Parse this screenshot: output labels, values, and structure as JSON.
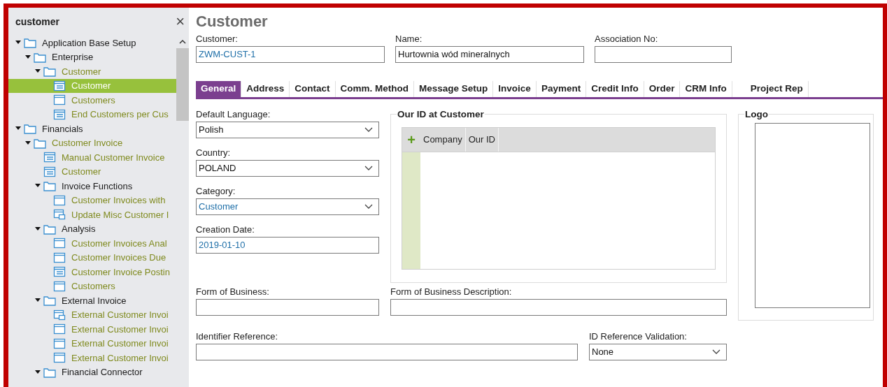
{
  "search": {
    "value": "customer",
    "close": "×"
  },
  "tree": [
    {
      "label": "Application Base Setup",
      "kind": "folder",
      "expanded": true,
      "match": false,
      "selected": false,
      "children": [
        {
          "label": "Enterprise",
          "kind": "folder",
          "expanded": true,
          "match": false,
          "selected": false,
          "children": [
            {
              "label": "Customer",
              "kind": "folder",
              "expanded": true,
              "match": true,
              "selected": false,
              "children": [
                {
                  "label": "Customer",
                  "kind": "form",
                  "selected": true
                },
                {
                  "label": "Customers",
                  "kind": "window",
                  "match": true,
                  "selected": false
                },
                {
                  "label": "End Customers per Cus",
                  "kind": "form",
                  "match": true,
                  "selected": false
                }
              ]
            }
          ]
        }
      ]
    },
    {
      "label": "Financials",
      "kind": "folder",
      "expanded": true,
      "match": false,
      "selected": false,
      "children": [
        {
          "label": "Customer Invoice",
          "kind": "folder",
          "expanded": true,
          "match": true,
          "selected": false,
          "children": [
            {
              "label": "Manual Customer Invoice",
              "kind": "form",
              "match": true,
              "selected": false
            },
            {
              "label": "Customer",
              "kind": "form",
              "match": true,
              "selected": false
            },
            {
              "label": "Invoice Functions",
              "kind": "folder",
              "expanded": true,
              "match": false,
              "selected": false,
              "children": [
                {
                  "label": "Customer Invoices with",
                  "kind": "window",
                  "match": true,
                  "selected": false
                },
                {
                  "label": "Update Misc Customer I",
                  "kind": "subwindow",
                  "match": true,
                  "selected": false
                }
              ]
            },
            {
              "label": "Analysis",
              "kind": "folder",
              "expanded": true,
              "match": false,
              "selected": false,
              "children": [
                {
                  "label": "Customer Invoices Anal",
                  "kind": "window",
                  "match": true,
                  "selected": false
                },
                {
                  "label": "Customer Invoices Due",
                  "kind": "window",
                  "match": true,
                  "selected": false
                },
                {
                  "label": "Customer Invoice Postin",
                  "kind": "form",
                  "match": true,
                  "selected": false
                },
                {
                  "label": "Customers",
                  "kind": "window",
                  "match": true,
                  "selected": false
                }
              ]
            },
            {
              "label": "External Invoice",
              "kind": "folder",
              "expanded": true,
              "match": false,
              "selected": false,
              "children": [
                {
                  "label": "External Customer Invoi",
                  "kind": "subwindow",
                  "match": true,
                  "selected": false
                },
                {
                  "label": "External Customer Invoi",
                  "kind": "window",
                  "match": true,
                  "selected": false
                },
                {
                  "label": "External Customer Invoi",
                  "kind": "window",
                  "match": true,
                  "selected": false
                },
                {
                  "label": "External Customer Invoi",
                  "kind": "window",
                  "match": true,
                  "selected": false
                }
              ]
            },
            {
              "label": "Financial Connector",
              "kind": "folder",
              "expanded": true,
              "match": false,
              "selected": false
            }
          ]
        }
      ]
    }
  ],
  "page": {
    "title": "Customer"
  },
  "header_fields": [
    {
      "label": "Customer:",
      "value": "ZWM-CUST-1",
      "reference": true
    },
    {
      "label": "Name:",
      "value": "Hurtownia wód mineralnych",
      "reference": false
    },
    {
      "label": "Association No:"
    }
  ],
  "tabs": [
    {
      "label": "General",
      "selected": true
    },
    {
      "label": "Address",
      "selected": false
    },
    {
      "label": "Contact",
      "selected": false
    },
    {
      "label": "Comm. Method",
      "selected": false
    },
    {
      "label": "Message Setup",
      "selected": false
    },
    {
      "label": "Invoice",
      "selected": false
    },
    {
      "label": "Payment",
      "selected": false
    },
    {
      "label": "Credit Info",
      "selected": false
    },
    {
      "label": "Order",
      "selected": false
    },
    {
      "label": "CRM Info",
      "selected": false
    },
    {
      "label": "Project Rep",
      "selected": false
    }
  ],
  "left_fields": [
    {
      "label": "Default Language:",
      "value": "Polish",
      "kind": "select",
      "reference": false
    },
    {
      "label": "Country:",
      "value": "POLAND",
      "kind": "select",
      "reference": false
    },
    {
      "label": "Category:",
      "value": "Customer",
      "kind": "select",
      "reference": true
    },
    {
      "label": "Creation Date:",
      "value": "2019-01-10",
      "kind": "text",
      "reference": true
    }
  ],
  "our_id": {
    "title": "Our ID at Customer",
    "add": "+",
    "columns": [
      "Company",
      "Our ID"
    ]
  },
  "logo": {
    "title": "Logo"
  },
  "form_of_business": {
    "label": "Form of Business:"
  },
  "form_of_business_description": {
    "label": "Form of Business Description:"
  },
  "identifier_reference": {
    "label": "Identifier Reference:"
  },
  "id_reference_validation": {
    "label": "ID Reference Validation:",
    "value": "None"
  }
}
